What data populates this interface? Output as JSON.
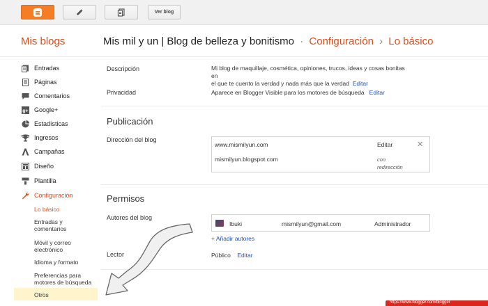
{
  "topbar": {
    "view_blog_label": "Ver blog"
  },
  "header": {
    "my_blogs": "Mis blogs",
    "blog_title": "Mis mil y un | Blog de belleza y bonitismo",
    "separator": "·",
    "section": "Configuración",
    "arrow": "›",
    "page": "Lo básico"
  },
  "sidebar": {
    "items": [
      {
        "label": "Entradas",
        "icon": "entries-icon"
      },
      {
        "label": "Páginas",
        "icon": "pages-icon"
      },
      {
        "label": "Comentarios",
        "icon": "comments-icon"
      },
      {
        "label": "Google+",
        "icon": "google-plus-icon"
      },
      {
        "label": "Estadísticas",
        "icon": "stats-icon"
      },
      {
        "label": "Ingresos",
        "icon": "trophy-icon"
      },
      {
        "label": "Campañas",
        "icon": "campaigns-icon"
      },
      {
        "label": "Diseño",
        "icon": "layout-icon"
      },
      {
        "label": "Plantilla",
        "icon": "template-icon"
      },
      {
        "label": "Configuración",
        "icon": "wrench-icon"
      }
    ],
    "sub_items": [
      "Lo básico",
      "Entradas y comentarios",
      "Móvil y correo electrónico",
      "Idioma y formato",
      "Preferencias para motores de búsqueda",
      "Otros"
    ]
  },
  "main": {
    "description_label": "Descripción",
    "description_line1": "Mi blog de maquillaje, cosmética, opiniones, trucos, ideas y cosas bonitas en",
    "description_line2": "el que te cuento la verdad y nada más que la verdad",
    "edit": "Editar",
    "privacy_label": "Privacidad",
    "privacy_value": "Aparece en Blogger Visible para los motores de búsqueda",
    "publication_title": "Publicación",
    "blog_address_label": "Dirección del blog",
    "custom_domain": "www.mismilyun.com",
    "blogspot_domain": "mismilyun.blogspot.com",
    "redirect_line1": "con",
    "redirect_line2": "redirección",
    "permissions_title": "Permisos",
    "authors_label": "Autores del blog",
    "author_name": "Ibuki",
    "author_email": "mismilyun@gmail.com",
    "author_role": "Administrador",
    "add_authors": "+ Añadir autores",
    "readers_label": "Lector",
    "readers_value": "Público"
  },
  "footer": {
    "status_url": "https://www.blogger.com/blogger"
  },
  "colors": {
    "accent": "#dd4b16",
    "link": "#1f4fb8",
    "blogger_orange": "#f57d26"
  }
}
